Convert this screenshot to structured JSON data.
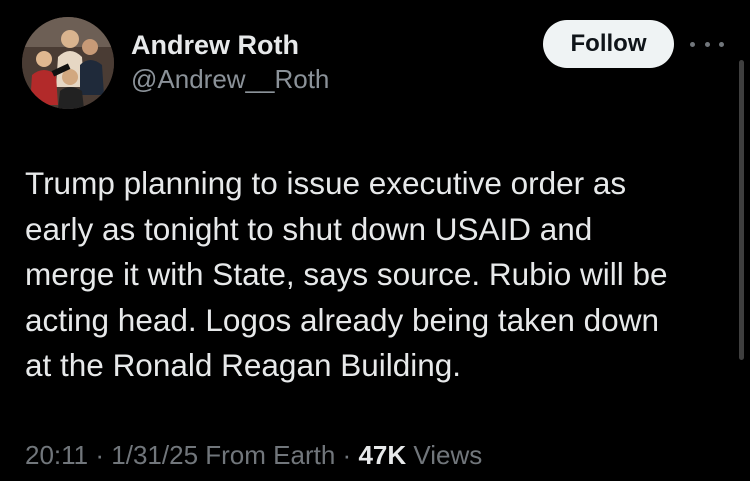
{
  "author": {
    "display_name": "Andrew Roth",
    "handle": "@Andrew__Roth"
  },
  "actions": {
    "follow_label": "Follow",
    "more_icon": "more-horizontal-icon"
  },
  "tweet": {
    "lines": [
      "Trump planning to issue executive order as",
      "early as tonight to shut down USAID and",
      "merge it with State, says source. Rubio will be",
      "acting head. Logos already being taken down",
      "at the Ronald Reagan Building."
    ]
  },
  "meta": {
    "time": "20:11",
    "date": "1/31/25",
    "source": "From Earth",
    "separator": "·",
    "views_count": "47K",
    "views_label": "Views"
  },
  "colors": {
    "background": "#000000",
    "text_primary": "#e7e9ea",
    "text_secondary": "#71767b",
    "follow_bg": "#eff3f4",
    "follow_text": "#0f1419"
  }
}
